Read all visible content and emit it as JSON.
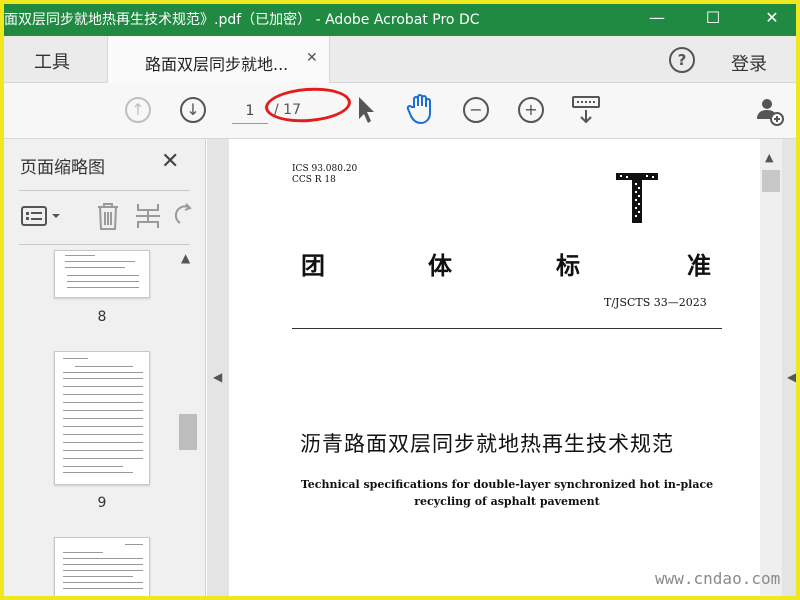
{
  "window": {
    "title": "面双层同步就地热再生技术规范》.pdf（已加密） - Adobe Acrobat Pro DC",
    "minimize": "—",
    "maximize": "☐",
    "close": "✕"
  },
  "tabs": {
    "tools_label": "工具",
    "doc_label": "路面双层同步就地...",
    "doc_close": "✕",
    "help": "?",
    "login": "登录"
  },
  "toolbar": {
    "prev_page": "↑",
    "next_page": "↓",
    "current_page": "1",
    "total_pages": "/ 17",
    "zoom_out": "−",
    "zoom_in": "+",
    "annotation_color": "#e21d1d"
  },
  "left_panel": {
    "title": "页面缩略图",
    "close": "✕",
    "thumbnails": [
      {
        "label": "8"
      },
      {
        "label": "9"
      }
    ]
  },
  "document": {
    "ics": "ICS 93.080.20",
    "ccs": "CCS  R  18",
    "big_letter": "T",
    "standard_type": [
      "团",
      "体",
      "标",
      "准"
    ],
    "standard_number": "T/JSCTS 33—2023",
    "title_cn": "沥青路面双层同步就地热再生技术规范",
    "title_en_line1": "Technical specifications for double-layer synchronized hot in-place",
    "title_en_line2": "recycling of asphalt pavement"
  },
  "watermark": "www.cndao.com",
  "colors": {
    "titlebar": "#208a43",
    "frame": "#f0e81e",
    "hand_tool": "#1a6fd6"
  }
}
